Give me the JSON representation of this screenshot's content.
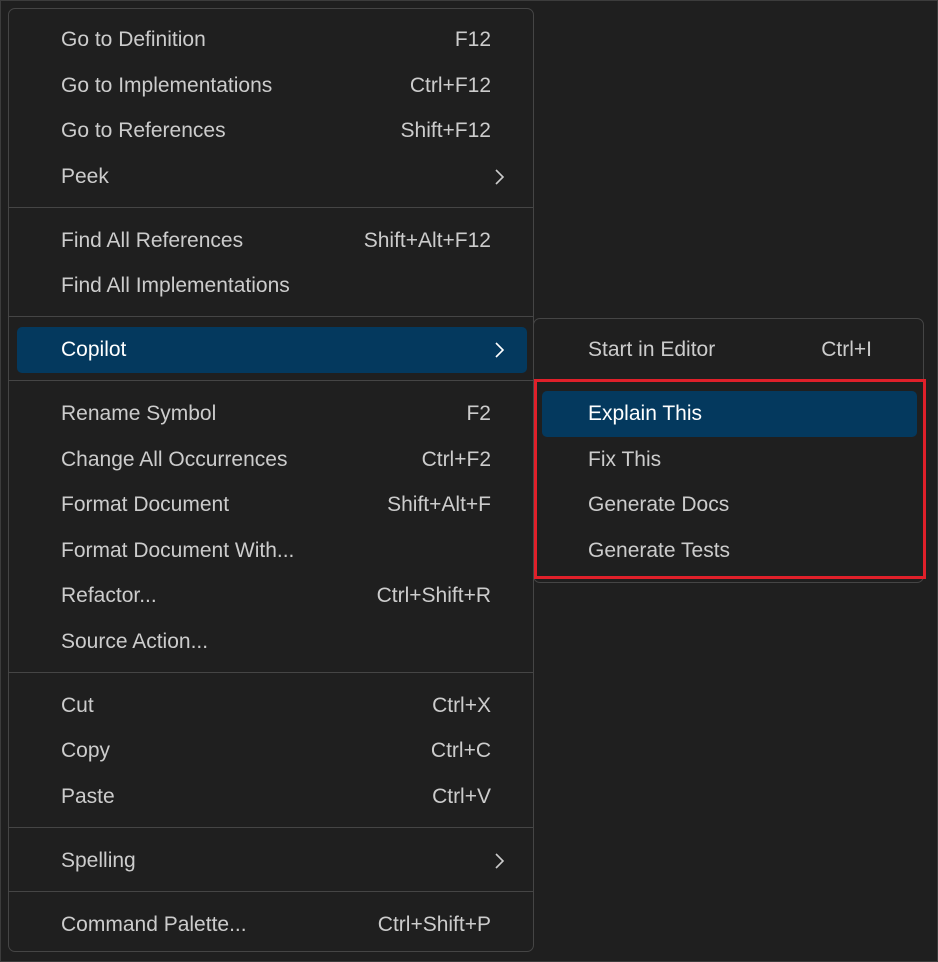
{
  "menu": {
    "group1": [
      {
        "label": "Go to Definition",
        "shortcut": "F12"
      },
      {
        "label": "Go to Implementations",
        "shortcut": "Ctrl+F12"
      },
      {
        "label": "Go to References",
        "shortcut": "Shift+F12"
      },
      {
        "label": "Peek",
        "shortcut": ""
      }
    ],
    "group2": [
      {
        "label": "Find All References",
        "shortcut": "Shift+Alt+F12"
      },
      {
        "label": "Find All Implementations",
        "shortcut": ""
      }
    ],
    "group3": [
      {
        "label": "Copilot",
        "shortcut": ""
      }
    ],
    "group4": [
      {
        "label": "Rename Symbol",
        "shortcut": "F2"
      },
      {
        "label": "Change All Occurrences",
        "shortcut": "Ctrl+F2"
      },
      {
        "label": "Format Document",
        "shortcut": "Shift+Alt+F"
      },
      {
        "label": "Format Document With...",
        "shortcut": ""
      },
      {
        "label": "Refactor...",
        "shortcut": "Ctrl+Shift+R"
      },
      {
        "label": "Source Action...",
        "shortcut": ""
      }
    ],
    "group5": [
      {
        "label": "Cut",
        "shortcut": "Ctrl+X"
      },
      {
        "label": "Copy",
        "shortcut": "Ctrl+C"
      },
      {
        "label": "Paste",
        "shortcut": "Ctrl+V"
      }
    ],
    "group6": [
      {
        "label": "Spelling",
        "shortcut": ""
      }
    ],
    "group7": [
      {
        "label": "Command Palette...",
        "shortcut": "Ctrl+Shift+P"
      }
    ]
  },
  "submenu": {
    "items": [
      {
        "label": "Start in Editor",
        "shortcut": "Ctrl+I"
      },
      {
        "label": "Explain This",
        "shortcut": ""
      },
      {
        "label": "Fix This",
        "shortcut": ""
      },
      {
        "label": "Generate Docs",
        "shortcut": ""
      },
      {
        "label": "Generate Tests",
        "shortcut": ""
      }
    ]
  },
  "colors": {
    "background": "#1f1f1f",
    "menu_text": "#cccccc",
    "active_background": "#04395e",
    "highlight_border": "#e0202a"
  }
}
